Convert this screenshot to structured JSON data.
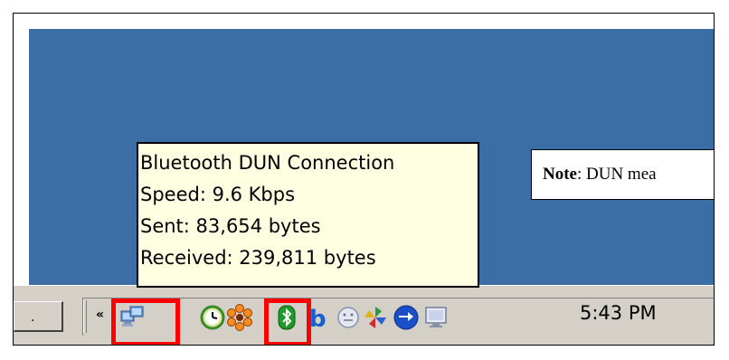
{
  "tooltip": {
    "title": "Bluetooth DUN Connection",
    "speed": "Speed: 9.6 Kbps",
    "sent": "Sent: 83,654 bytes",
    "received": "Received: 239,811 bytes"
  },
  "note": {
    "label": "Note",
    "text": ": DUN mea"
  },
  "taskbar": {
    "button_label": ".",
    "chevron": "«",
    "clock": "5:43 PM"
  },
  "tray_icons": [
    "network-connections-icon",
    "clock-icon",
    "sun-icon",
    "bluetooth-icon",
    "b-app-icon",
    "messenger-icon",
    "pinwheel-icon",
    "sync-arrows-icon",
    "monitor-icon"
  ],
  "colors": {
    "desktop": "#3a6ea5",
    "taskbar": "#d4d0c8",
    "tooltip": "#ffffe1",
    "highlight": "#ff0000"
  }
}
